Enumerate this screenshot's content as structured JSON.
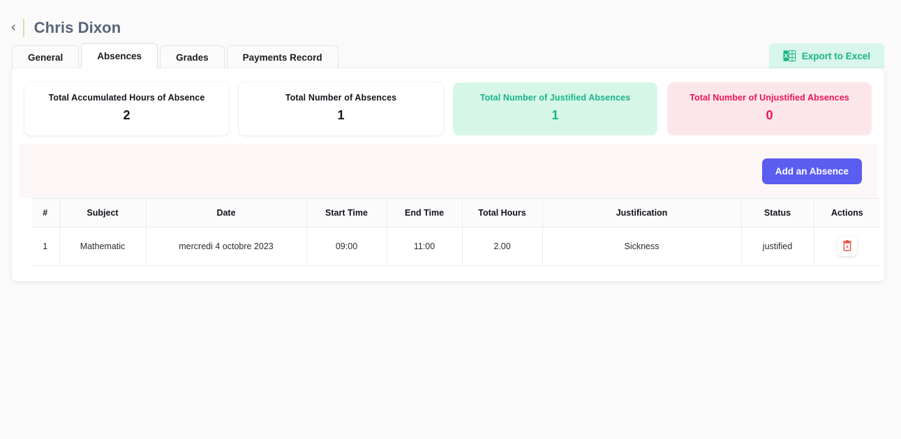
{
  "header": {
    "back_icon": "chevron-left-icon",
    "title": "Chris Dixon"
  },
  "tabs": [
    {
      "label": "General",
      "active": false
    },
    {
      "label": "Absences",
      "active": true
    },
    {
      "label": "Grades",
      "active": false
    },
    {
      "label": "Payments Record",
      "active": false
    }
  ],
  "export": {
    "label": "Export to Excel",
    "icon": "excel-file-icon",
    "bg": "#d8f6e9",
    "color": "#18b386"
  },
  "stats": [
    {
      "label": "Total Accumulated Hours of Absence",
      "value": "2",
      "variant": "plain"
    },
    {
      "label": "Total Number of Absences",
      "value": "1",
      "variant": "plain"
    },
    {
      "label": "Total Number of Justified Absences",
      "value": "1",
      "variant": "green",
      "color": "#19b487",
      "bg": "#d6f7e7"
    },
    {
      "label": "Total Number of Unjustified Absences",
      "value": "0",
      "variant": "red",
      "color": "#e8125c",
      "bg": "#fde6ea"
    }
  ],
  "actions": {
    "add_absence_label": "Add an Absence",
    "add_absence_bg": "#5b5cf0",
    "band_bg": "#fdf6f6"
  },
  "table": {
    "columns": [
      "#",
      "Subject",
      "Date",
      "Start Time",
      "End Time",
      "Total Hours",
      "Justification",
      "Status",
      "Actions"
    ],
    "rows": [
      {
        "num": "1",
        "subject": "Mathematic",
        "date": "mercredi 4 octobre 2023",
        "start_time": "09:00",
        "end_time": "11:00",
        "total_hours": "2.00",
        "justification": "Sickness",
        "status": "justified",
        "action_icon": "trash-delete-icon"
      }
    ]
  }
}
